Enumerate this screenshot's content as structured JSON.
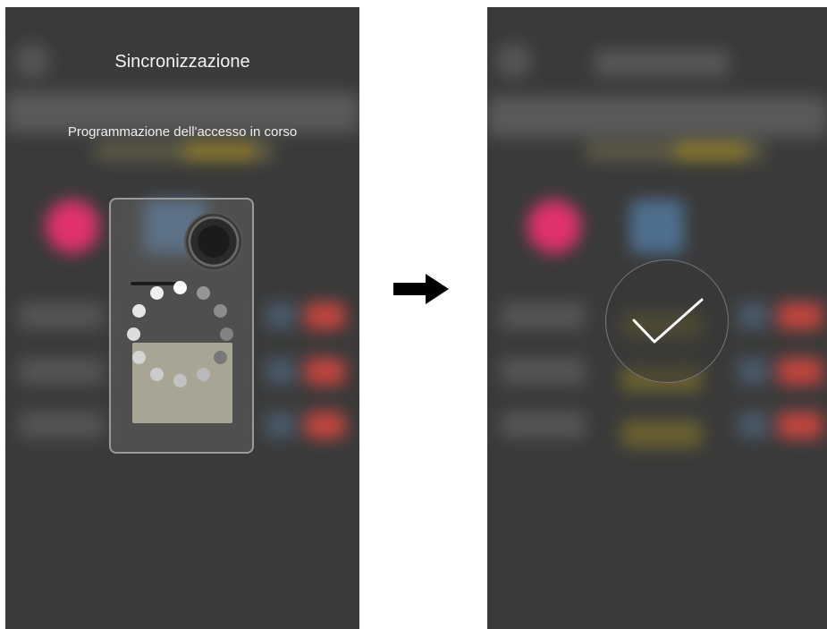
{
  "sync_screen": {
    "title": "Sincronizzazione",
    "subtitle": "Programmazione dell'accesso in corso",
    "spinner_icon": "loading-spinner-icon",
    "device_icon": "door-entry-panel-icon"
  },
  "transition": {
    "icon": "right-arrow-icon"
  },
  "success_screen": {
    "icon": "checkmark-icon"
  },
  "colors": {
    "screen_bg": "#3a3a3a",
    "text": "#f2f2f2",
    "accent_pink": "#e0326b",
    "accent_blue": "#4f6f8f",
    "accent_yellow": "#b8a030",
    "accent_red": "#c4453f"
  }
}
